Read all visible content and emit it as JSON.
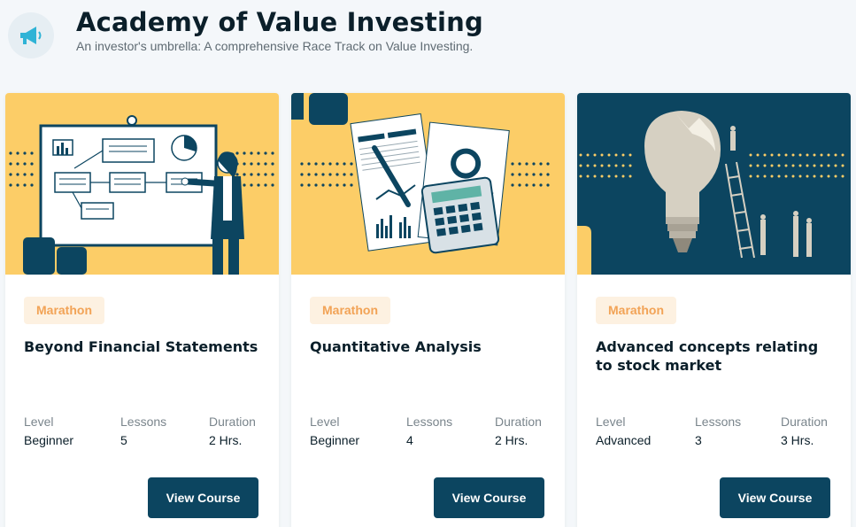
{
  "header": {
    "icon": "megaphone-icon",
    "title": "Academy of Value Investing",
    "subtitle": "An investor's umbrella: A comprehensive Race Track on Value Investing."
  },
  "labels": {
    "level": "Level",
    "lessons": "Lessons",
    "duration": "Duration"
  },
  "colors": {
    "primary": "#0c4560",
    "accent_yellow": "#fccd67",
    "tag_bg": "#fdf1e1",
    "tag_text": "#f2a356"
  },
  "courses": [
    {
      "tag": "Marathon",
      "title": "Beyond Financial Statements",
      "level": "Beginner",
      "lessons": "5",
      "duration": "2 Hrs.",
      "button": "View Course",
      "image": "presentation-illustration"
    },
    {
      "tag": "Marathon",
      "title": "Quantitative Analysis",
      "level": "Beginner",
      "lessons": "4",
      "duration": "2 Hrs.",
      "button": "View Course",
      "image": "balance-sheets-illustration"
    },
    {
      "tag": "Marathon",
      "title": "Advanced concepts relating to stock market",
      "level": "Advanced",
      "lessons": "3",
      "duration": "3 Hrs.",
      "button": "View Course",
      "image": "lightbulb-illustration"
    }
  ]
}
